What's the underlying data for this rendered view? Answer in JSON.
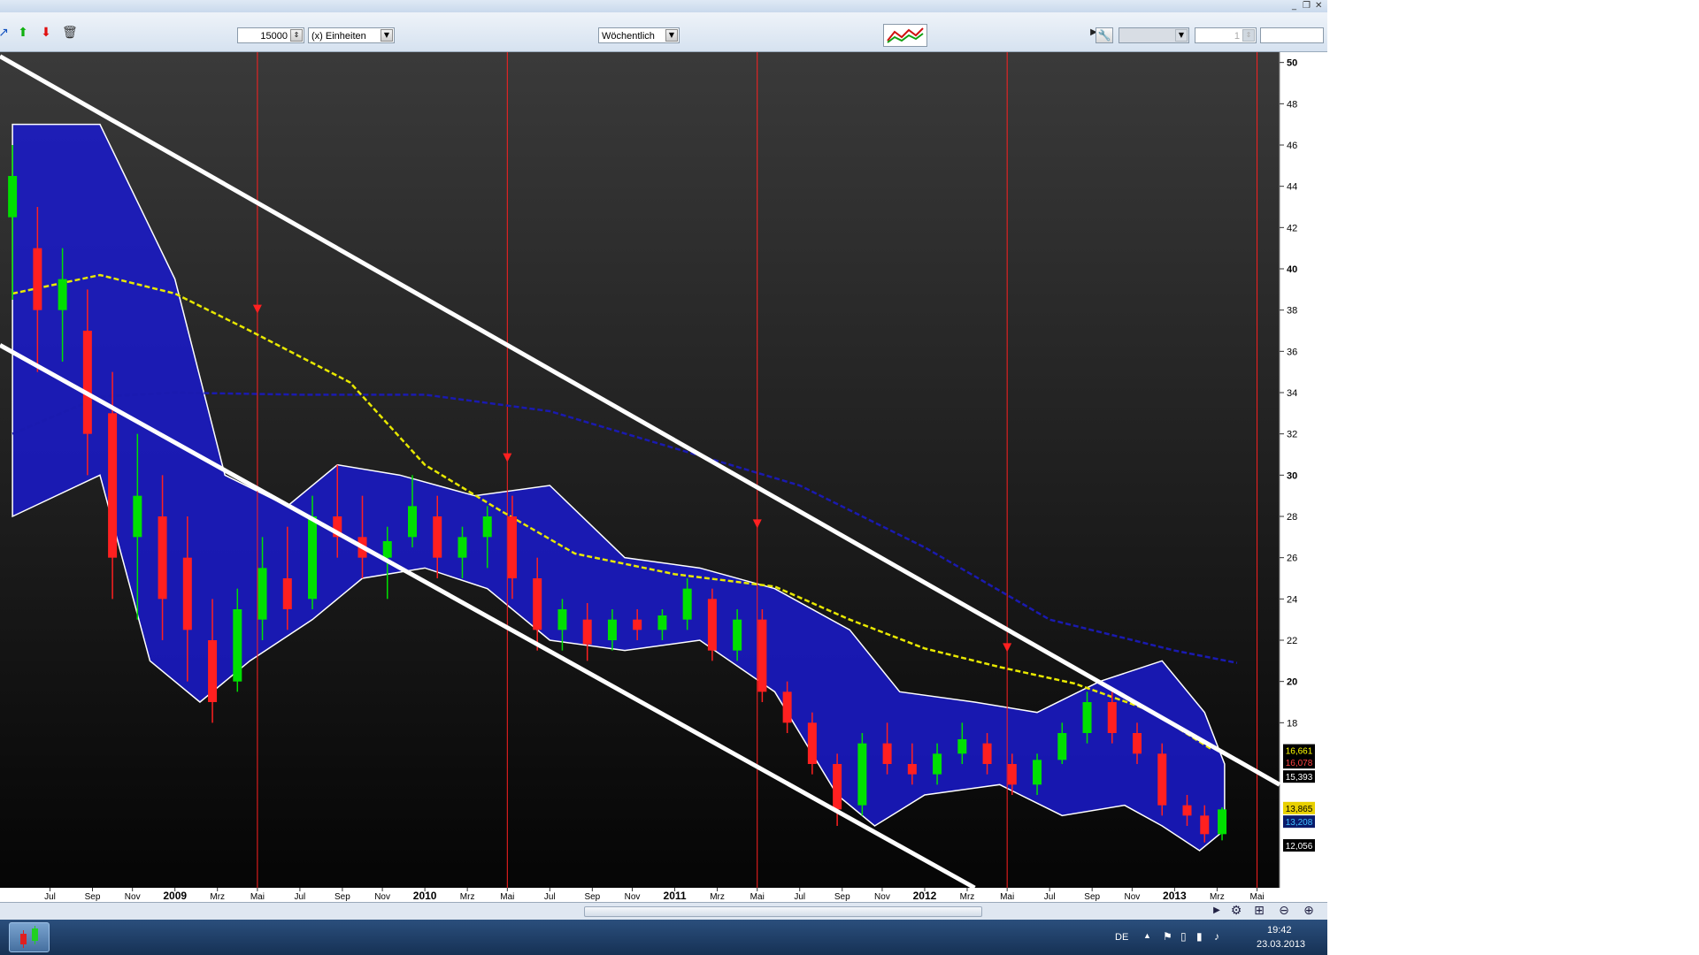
{
  "window": {
    "minimize": "_",
    "restore": "❐",
    "close": "✕"
  },
  "toolbar": {
    "quantity_value": "15000",
    "units_label": "(x) Einheiten",
    "period_label": "Wöchentlich",
    "right_field_value": "1"
  },
  "taskbar": {
    "language": "DE",
    "time": "19:42",
    "date": "23.03.2013"
  },
  "colors": {
    "bull_candle": "#00e000",
    "bear_candle": "#ff2020",
    "channel": "#ffffff",
    "cloud": "#1a1aff",
    "ma_yellow": "#e8e800",
    "ma_blue": "#1a1ab0"
  },
  "chart_data": {
    "type": "candlestick",
    "title": "",
    "xlabel": "",
    "ylabel": "",
    "ylim": [
      10,
      50.5
    ],
    "y_ticks": [
      18,
      20,
      22,
      24,
      26,
      28,
      30,
      32,
      34,
      36,
      38,
      40,
      42,
      44,
      46,
      48,
      50
    ],
    "x_labels": [
      {
        "label": "Jul",
        "t": 2008.5
      },
      {
        "label": "Sep",
        "t": 2008.67
      },
      {
        "label": "Nov",
        "t": 2008.83
      },
      {
        "label": "2009",
        "t": 2009.0
      },
      {
        "label": "Mrz",
        "t": 2009.17
      },
      {
        "label": "Mai",
        "t": 2009.33
      },
      {
        "label": "Jul",
        "t": 2009.5
      },
      {
        "label": "Sep",
        "t": 2009.67
      },
      {
        "label": "Nov",
        "t": 2009.83
      },
      {
        "label": "2010",
        "t": 2010.0
      },
      {
        "label": "Mrz",
        "t": 2010.17
      },
      {
        "label": "Mai",
        "t": 2010.33
      },
      {
        "label": "Jul",
        "t": 2010.5
      },
      {
        "label": "Sep",
        "t": 2010.67
      },
      {
        "label": "Nov",
        "t": 2010.83
      },
      {
        "label": "2011",
        "t": 2011.0
      },
      {
        "label": "Mrz",
        "t": 2011.17
      },
      {
        "label": "Mai",
        "t": 2011.33
      },
      {
        "label": "Jul",
        "t": 2011.5
      },
      {
        "label": "Sep",
        "t": 2011.67
      },
      {
        "label": "Nov",
        "t": 2011.83
      },
      {
        "label": "2012",
        "t": 2012.0
      },
      {
        "label": "Mrz",
        "t": 2012.17
      },
      {
        "label": "Mai",
        "t": 2012.33
      },
      {
        "label": "Jul",
        "t": 2012.5
      },
      {
        "label": "Sep",
        "t": 2012.67
      },
      {
        "label": "Nov",
        "t": 2012.83
      },
      {
        "label": "2013",
        "t": 2013.0
      },
      {
        "label": "Mrz",
        "t": 2013.17
      },
      {
        "label": "Mai",
        "t": 2013.33
      }
    ],
    "price_labels": [
      {
        "label": "16,661",
        "value": 16.661,
        "bg": "#000000",
        "fg": "#ffff00"
      },
      {
        "label": "16,078",
        "value": 16.078,
        "bg": "#000000",
        "fg": "#ff4040"
      },
      {
        "label": "15,393",
        "value": 15.393,
        "bg": "#000000",
        "fg": "#ffffff"
      },
      {
        "label": "13,865",
        "value": 13.865,
        "bg": "#e8d000",
        "fg": "#000000"
      },
      {
        "label": "13,208",
        "value": 13.208,
        "bg": "#0a1a6a",
        "fg": "#40c0ff"
      },
      {
        "label": "12,056",
        "value": 12.056,
        "bg": "#000000",
        "fg": "#ffffff"
      }
    ],
    "vertical_markers": [
      2009.33,
      2010.33,
      2011.33,
      2012.33,
      2013.33
    ],
    "signal_arrows": [
      {
        "t": 2009.33,
        "y": 38.0
      },
      {
        "t": 2010.33,
        "y": 30.8
      },
      {
        "t": 2011.33,
        "y": 27.6
      },
      {
        "t": 2012.33,
        "y": 21.6
      }
    ],
    "channel_lines": [
      {
        "name": "",
        "t1": 2008.3,
        "y1": 50.3,
        "t2": 2013.42,
        "y2": 15.0
      },
      {
        "name": "",
        "t1": 2008.3,
        "y1": 36.3,
        "t2": 2012.2,
        "y2": 10.0
      }
    ],
    "ma_yellow": [
      [
        2008.35,
        38.8
      ],
      [
        2008.7,
        39.7
      ],
      [
        2009.0,
        38.8
      ],
      [
        2009.3,
        37.0
      ],
      [
        2009.7,
        34.5
      ],
      [
        2010.0,
        30.5
      ],
      [
        2010.3,
        28.3
      ],
      [
        2010.6,
        26.2
      ],
      [
        2011.0,
        25.2
      ],
      [
        2011.4,
        24.6
      ],
      [
        2011.7,
        23.0
      ],
      [
        2012.0,
        21.6
      ],
      [
        2012.3,
        20.7
      ],
      [
        2012.6,
        19.9
      ],
      [
        2012.9,
        18.6
      ],
      [
        2013.15,
        16.7
      ]
    ],
    "ma_blue": [
      [
        2008.35,
        32.0
      ],
      [
        2008.7,
        33.8
      ],
      [
        2009.0,
        34.0
      ],
      [
        2009.5,
        33.9
      ],
      [
        2010.0,
        33.9
      ],
      [
        2010.5,
        33.1
      ],
      [
        2011.0,
        31.3
      ],
      [
        2011.5,
        29.5
      ],
      [
        2012.0,
        26.5
      ],
      [
        2012.5,
        23.0
      ],
      [
        2013.0,
        21.5
      ],
      [
        2013.25,
        20.9
      ]
    ],
    "cloud": {
      "upper": [
        [
          2008.35,
          47.0
        ],
        [
          2008.7,
          47.0
        ],
        [
          2009.0,
          39.5
        ],
        [
          2009.2,
          30.0
        ],
        [
          2009.45,
          28.5
        ],
        [
          2009.65,
          30.5
        ],
        [
          2009.9,
          30.0
        ],
        [
          2010.2,
          29.0
        ],
        [
          2010.5,
          29.5
        ],
        [
          2010.8,
          26.0
        ],
        [
          2011.1,
          25.5
        ],
        [
          2011.4,
          24.5
        ],
        [
          2011.7,
          22.5
        ],
        [
          2011.9,
          19.5
        ],
        [
          2012.2,
          19.0
        ],
        [
          2012.45,
          18.5
        ],
        [
          2012.7,
          20.0
        ],
        [
          2012.95,
          21.0
        ],
        [
          2013.12,
          18.5
        ],
        [
          2013.2,
          16.0
        ]
      ],
      "lower": [
        [
          2008.35,
          28.0
        ],
        [
          2008.7,
          30.0
        ],
        [
          2008.9,
          21.0
        ],
        [
          2009.1,
          19.0
        ],
        [
          2009.3,
          21.0
        ],
        [
          2009.55,
          23.0
        ],
        [
          2009.75,
          25.0
        ],
        [
          2010.0,
          25.5
        ],
        [
          2010.25,
          24.5
        ],
        [
          2010.5,
          22.0
        ],
        [
          2010.8,
          21.5
        ],
        [
          2011.1,
          22.0
        ],
        [
          2011.4,
          19.5
        ],
        [
          2011.65,
          14.5
        ],
        [
          2011.8,
          13.0
        ],
        [
          2012.0,
          14.5
        ],
        [
          2012.3,
          15.0
        ],
        [
          2012.55,
          13.5
        ],
        [
          2012.8,
          14.0
        ],
        [
          2012.95,
          13.0
        ],
        [
          2013.1,
          11.8
        ],
        [
          2013.2,
          12.8
        ]
      ]
    },
    "candles": [
      {
        "t": 2008.35,
        "o": 42.5,
        "h": 46.0,
        "l": 38.5,
        "c": 44.5
      },
      {
        "t": 2008.45,
        "o": 41.0,
        "h": 43.0,
        "l": 35.0,
        "c": 38.0
      },
      {
        "t": 2008.55,
        "o": 38.0,
        "h": 41.0,
        "l": 35.5,
        "c": 39.5
      },
      {
        "t": 2008.65,
        "o": 37.0,
        "h": 39.0,
        "l": 30.0,
        "c": 32.0
      },
      {
        "t": 2008.75,
        "o": 33.0,
        "h": 35.0,
        "l": 24.0,
        "c": 26.0
      },
      {
        "t": 2008.85,
        "o": 27.0,
        "h": 32.0,
        "l": 23.0,
        "c": 29.0
      },
      {
        "t": 2008.95,
        "o": 28.0,
        "h": 30.0,
        "l": 22.0,
        "c": 24.0
      },
      {
        "t": 2009.05,
        "o": 26.0,
        "h": 28.0,
        "l": 20.0,
        "c": 22.5
      },
      {
        "t": 2009.15,
        "o": 22.0,
        "h": 24.0,
        "l": 18.0,
        "c": 19.0
      },
      {
        "t": 2009.25,
        "o": 20.0,
        "h": 24.5,
        "l": 19.5,
        "c": 23.5
      },
      {
        "t": 2009.35,
        "o": 23.0,
        "h": 27.0,
        "l": 22.0,
        "c": 25.5
      },
      {
        "t": 2009.45,
        "o": 25.0,
        "h": 27.5,
        "l": 22.5,
        "c": 23.5
      },
      {
        "t": 2009.55,
        "o": 24.0,
        "h": 29.0,
        "l": 23.5,
        "c": 28.0
      },
      {
        "t": 2009.65,
        "o": 28.0,
        "h": 30.5,
        "l": 26.0,
        "c": 27.0
      },
      {
        "t": 2009.75,
        "o": 27.0,
        "h": 29.0,
        "l": 25.0,
        "c": 26.0
      },
      {
        "t": 2009.85,
        "o": 26.0,
        "h": 27.5,
        "l": 24.0,
        "c": 26.8
      },
      {
        "t": 2009.95,
        "o": 27.0,
        "h": 30.0,
        "l": 26.5,
        "c": 28.5
      },
      {
        "t": 2010.05,
        "o": 28.0,
        "h": 29.0,
        "l": 25.0,
        "c": 26.0
      },
      {
        "t": 2010.15,
        "o": 26.0,
        "h": 27.5,
        "l": 25.0,
        "c": 27.0
      },
      {
        "t": 2010.25,
        "o": 27.0,
        "h": 28.5,
        "l": 25.5,
        "c": 28.0
      },
      {
        "t": 2010.35,
        "o": 28.0,
        "h": 29.0,
        "l": 24.0,
        "c": 25.0
      },
      {
        "t": 2010.45,
        "o": 25.0,
        "h": 26.0,
        "l": 21.5,
        "c": 22.5
      },
      {
        "t": 2010.55,
        "o": 22.5,
        "h": 24.0,
        "l": 21.5,
        "c": 23.5
      },
      {
        "t": 2010.65,
        "o": 23.0,
        "h": 23.8,
        "l": 21.0,
        "c": 21.8
      },
      {
        "t": 2010.75,
        "o": 22.0,
        "h": 23.5,
        "l": 21.5,
        "c": 23.0
      },
      {
        "t": 2010.85,
        "o": 23.0,
        "h": 23.5,
        "l": 22.0,
        "c": 22.5
      },
      {
        "t": 2010.95,
        "o": 22.5,
        "h": 23.5,
        "l": 22.0,
        "c": 23.2
      },
      {
        "t": 2011.05,
        "o": 23.0,
        "h": 25.0,
        "l": 22.5,
        "c": 24.5
      },
      {
        "t": 2011.15,
        "o": 24.0,
        "h": 24.5,
        "l": 21.0,
        "c": 21.5
      },
      {
        "t": 2011.25,
        "o": 21.5,
        "h": 23.5,
        "l": 21.0,
        "c": 23.0
      },
      {
        "t": 2011.35,
        "o": 23.0,
        "h": 23.5,
        "l": 19.0,
        "c": 19.5
      },
      {
        "t": 2011.45,
        "o": 19.5,
        "h": 20.0,
        "l": 17.5,
        "c": 18.0
      },
      {
        "t": 2011.55,
        "o": 18.0,
        "h": 18.5,
        "l": 15.5,
        "c": 16.0
      },
      {
        "t": 2011.65,
        "o": 16.0,
        "h": 16.5,
        "l": 13.0,
        "c": 13.8
      },
      {
        "t": 2011.75,
        "o": 14.0,
        "h": 17.5,
        "l": 13.5,
        "c": 17.0
      },
      {
        "t": 2011.85,
        "o": 17.0,
        "h": 18.0,
        "l": 15.5,
        "c": 16.0
      },
      {
        "t": 2011.95,
        "o": 16.0,
        "h": 17.0,
        "l": 15.0,
        "c": 15.5
      },
      {
        "t": 2012.05,
        "o": 15.5,
        "h": 17.0,
        "l": 15.0,
        "c": 16.5
      },
      {
        "t": 2012.15,
        "o": 16.5,
        "h": 18.0,
        "l": 16.0,
        "c": 17.2
      },
      {
        "t": 2012.25,
        "o": 17.0,
        "h": 17.5,
        "l": 15.5,
        "c": 16.0
      },
      {
        "t": 2012.35,
        "o": 16.0,
        "h": 16.5,
        "l": 14.5,
        "c": 15.0
      },
      {
        "t": 2012.45,
        "o": 15.0,
        "h": 16.5,
        "l": 14.5,
        "c": 16.2
      },
      {
        "t": 2012.55,
        "o": 16.2,
        "h": 18.0,
        "l": 16.0,
        "c": 17.5
      },
      {
        "t": 2012.65,
        "o": 17.5,
        "h": 19.5,
        "l": 17.0,
        "c": 19.0
      },
      {
        "t": 2012.75,
        "o": 19.0,
        "h": 19.5,
        "l": 17.0,
        "c": 17.5
      },
      {
        "t": 2012.85,
        "o": 17.5,
        "h": 18.0,
        "l": 16.0,
        "c": 16.5
      },
      {
        "t": 2012.95,
        "o": 16.5,
        "h": 17.0,
        "l": 13.5,
        "c": 14.0
      },
      {
        "t": 2013.05,
        "o": 14.0,
        "h": 14.5,
        "l": 13.0,
        "c": 13.5
      },
      {
        "t": 2013.12,
        "o": 13.5,
        "h": 14.0,
        "l": 12.2,
        "c": 12.6
      },
      {
        "t": 2013.19,
        "o": 12.6,
        "h": 13.9,
        "l": 12.3,
        "c": 13.8
      }
    ]
  }
}
